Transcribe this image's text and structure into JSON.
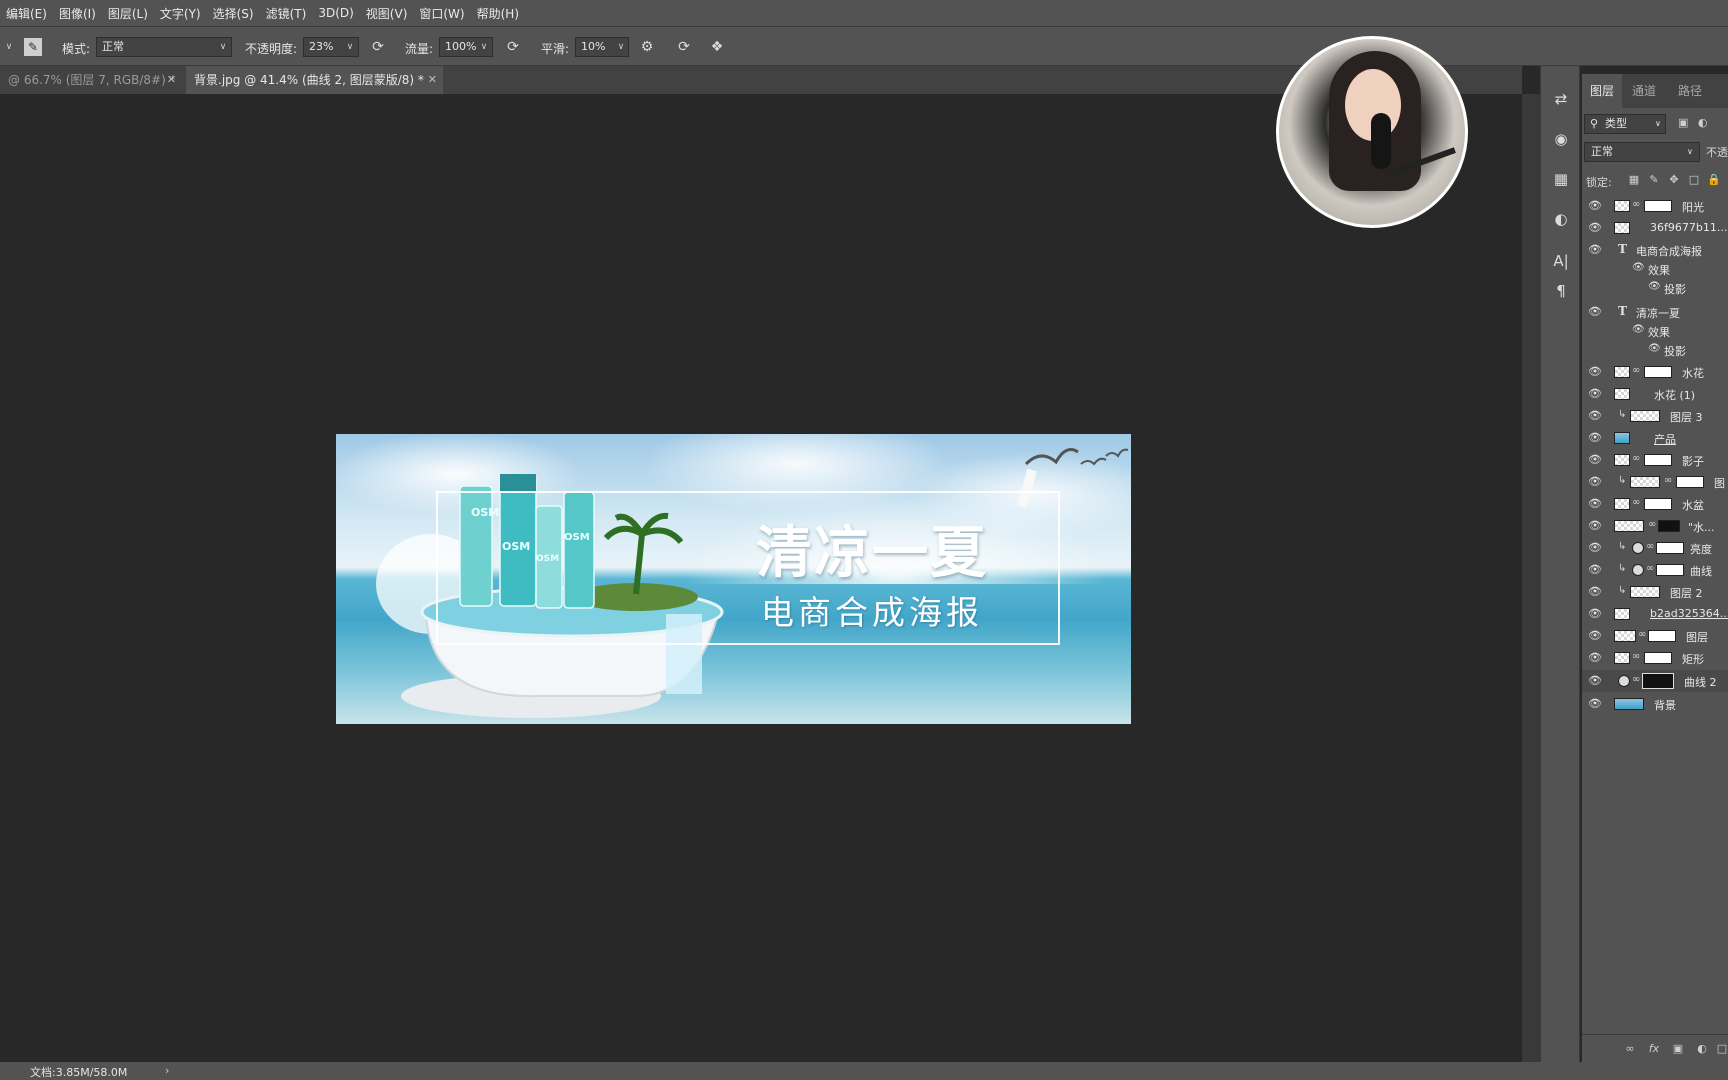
{
  "menubar": {
    "items": [
      "编辑(E)",
      "图像(I)",
      "图层(L)",
      "文字(Y)",
      "选择(S)",
      "滤镜(T)",
      "3D(D)",
      "视图(V)",
      "窗口(W)",
      "帮助(H)"
    ]
  },
  "options": {
    "mode_label": "模式:",
    "mode_value": "正常",
    "opacity_label": "不透明度:",
    "opacity_value": "23%",
    "flow_label": "流量:",
    "flow_value": "100%",
    "smooth_label": "平滑:",
    "smooth_value": "10%"
  },
  "tabs": [
    {
      "label": "@ 66.7% (图层 7, RGB/8#) *",
      "active": false
    },
    {
      "label": "背景.jpg @ 41.4% (曲线 2, 图层蒙版/8) *",
      "active": true
    }
  ],
  "banner": {
    "title": "清凉一夏",
    "subtitle": "电商合成海报",
    "brand": "OSM"
  },
  "status": {
    "doc_info": "文档:3.85M/58.0M",
    "arrow": "›"
  },
  "panel": {
    "tabs": [
      "图层",
      "通道",
      "路径"
    ],
    "filter_value": "类型",
    "blend_value": "正常",
    "opacity_label": "不透",
    "lock_label": "锁定:"
  },
  "layers": [
    {
      "name": "阳光",
      "kind": "smart-mask"
    },
    {
      "name": "36f9677b11...3",
      "kind": "smart"
    },
    {
      "name": "电商合成海报",
      "kind": "text"
    },
    {
      "name": "效果",
      "kind": "effects"
    },
    {
      "name": "投影",
      "kind": "effect"
    },
    {
      "name": "清凉一夏",
      "kind": "text"
    },
    {
      "name": "效果",
      "kind": "effects"
    },
    {
      "name": "投影",
      "kind": "effect"
    },
    {
      "name": "水花",
      "kind": "smart-mask"
    },
    {
      "name": "水花 (1)",
      "kind": "smart"
    },
    {
      "name": "图层 3",
      "kind": "clip"
    },
    {
      "name": "产品",
      "kind": "smart-img"
    },
    {
      "name": "影子",
      "kind": "smart-mask"
    },
    {
      "name": "图",
      "kind": "clip-mask"
    },
    {
      "name": "水盆",
      "kind": "smart-mask"
    },
    {
      "name": "\"水...",
      "kind": "mask-dark"
    },
    {
      "name": "亮度",
      "kind": "adj-clip"
    },
    {
      "name": "曲线",
      "kind": "adj-clip"
    },
    {
      "name": "图层 2",
      "kind": "clip"
    },
    {
      "name": "b2ad325364...",
      "kind": "smart"
    },
    {
      "name": "图层",
      "kind": "mask"
    },
    {
      "name": "矩形",
      "kind": "mask"
    },
    {
      "name": "曲线 2",
      "kind": "adj-dark"
    },
    {
      "name": "背景",
      "kind": "bg"
    }
  ]
}
